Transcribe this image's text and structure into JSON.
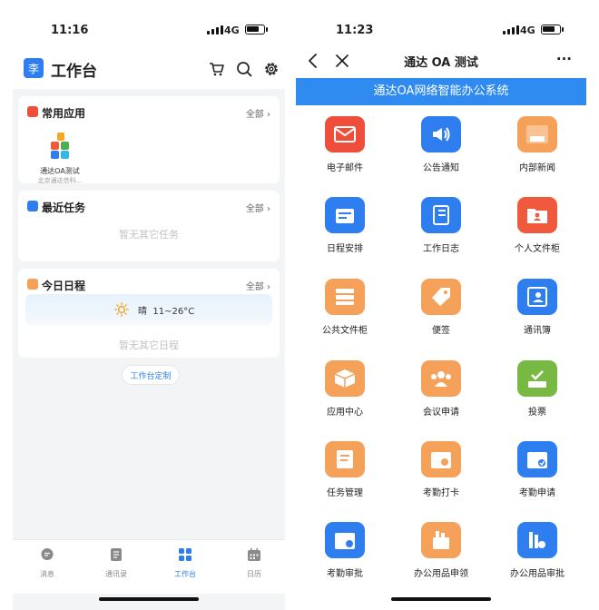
{
  "left": {
    "status": {
      "time": "11:16",
      "network": "4G"
    },
    "header": {
      "avatar_char": "李",
      "title": "工作台",
      "icons": [
        "cart-icon",
        "search-icon",
        "gear-icon"
      ]
    },
    "common_apps": {
      "title": "常用应用",
      "all_label": "全部",
      "app": {
        "name": "通达OA测试",
        "org": "北京通达信科..."
      }
    },
    "recent_tasks": {
      "title": "最近任务",
      "all_label": "全部",
      "empty": "暂无其它任务"
    },
    "today_schedule": {
      "title": "今日日程",
      "all_label": "全部",
      "weather": {
        "condition": "晴",
        "temp": "11~26°C",
        "icon": "sun-icon"
      },
      "empty": "暂无其它日程"
    },
    "customize_label": "工作台定制",
    "tabs": [
      {
        "label": "消息",
        "icon": "message-icon",
        "active": false
      },
      {
        "label": "通讯录",
        "icon": "contacts-icon",
        "active": false
      },
      {
        "label": "工作台",
        "icon": "workbench-icon",
        "active": true
      },
      {
        "label": "日历",
        "icon": "calendar-icon",
        "active": false
      }
    ]
  },
  "right": {
    "status": {
      "time": "11:23",
      "network": "4G"
    },
    "nav": {
      "title": "通达 OA 测试",
      "more": "···"
    },
    "banner": "通达OA网络智能办公系统",
    "apps": [
      {
        "label": "电子邮件",
        "icon": "mail-icon",
        "color": "#ef4e3a"
      },
      {
        "label": "公告通知",
        "icon": "megaphone-icon",
        "color": "#2f7ef0"
      },
      {
        "label": "内部新闻",
        "icon": "news-icon",
        "color": "#f5a15a"
      },
      {
        "label": "日程安排",
        "icon": "schedule-icon",
        "color": "#2f7ef0"
      },
      {
        "label": "工作日志",
        "icon": "journal-icon",
        "color": "#2f7ef0"
      },
      {
        "label": "个人文件柜",
        "icon": "personal-folder-icon",
        "color": "#f05a3c"
      },
      {
        "label": "公共文件柜",
        "icon": "server-icon",
        "color": "#f5a15a"
      },
      {
        "label": "便签",
        "icon": "tag-icon",
        "color": "#f5a15a"
      },
      {
        "label": "通讯簿",
        "icon": "address-book-icon",
        "color": "#2f7ef0"
      },
      {
        "label": "应用中心",
        "icon": "box-icon",
        "color": "#f5a15a"
      },
      {
        "label": "会议申请",
        "icon": "people-icon",
        "color": "#f5a15a"
      },
      {
        "label": "投票",
        "icon": "vote-icon",
        "color": "#78b944"
      },
      {
        "label": "任务管理",
        "icon": "task-icon",
        "color": "#f5a15a"
      },
      {
        "label": "考勤打卡",
        "icon": "clock-in-icon",
        "color": "#f5a15a"
      },
      {
        "label": "考勤申请",
        "icon": "attendance-apply-icon",
        "color": "#2f7ef0"
      },
      {
        "label": "考勤审批",
        "icon": "attendance-approve-icon",
        "color": "#2f7ef0"
      },
      {
        "label": "办公用品申领",
        "icon": "supplies-request-icon",
        "color": "#f5a15a"
      },
      {
        "label": "办公用品审批",
        "icon": "supplies-approve-icon",
        "color": "#2f7ef0"
      }
    ]
  }
}
